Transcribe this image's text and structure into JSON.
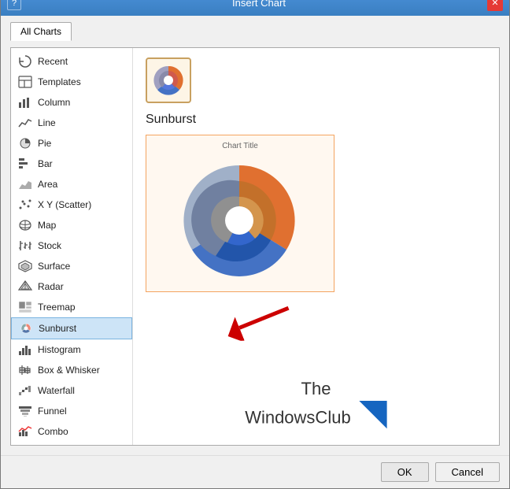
{
  "dialog": {
    "title": "Insert Chart",
    "help_label": "?",
    "close_label": "✕"
  },
  "tabs": [
    {
      "id": "all-charts",
      "label": "All Charts",
      "active": true
    }
  ],
  "sidebar": {
    "items": [
      {
        "id": "recent",
        "label": "Recent",
        "icon": "recent-icon",
        "active": false
      },
      {
        "id": "templates",
        "label": "Templates",
        "icon": "templates-icon",
        "active": false
      },
      {
        "id": "column",
        "label": "Column",
        "icon": "column-icon",
        "active": false
      },
      {
        "id": "line",
        "label": "Line",
        "icon": "line-icon",
        "active": false
      },
      {
        "id": "pie",
        "label": "Pie",
        "icon": "pie-icon",
        "active": false
      },
      {
        "id": "bar",
        "label": "Bar",
        "icon": "bar-icon",
        "active": false
      },
      {
        "id": "area",
        "label": "Area",
        "icon": "area-icon",
        "active": false
      },
      {
        "id": "xyscatter",
        "label": "X Y (Scatter)",
        "icon": "scatter-icon",
        "active": false
      },
      {
        "id": "map",
        "label": "Map",
        "icon": "map-icon",
        "active": false
      },
      {
        "id": "stock",
        "label": "Stock",
        "icon": "stock-icon",
        "active": false
      },
      {
        "id": "surface",
        "label": "Surface",
        "icon": "surface-icon",
        "active": false
      },
      {
        "id": "radar",
        "label": "Radar",
        "icon": "radar-icon",
        "active": false
      },
      {
        "id": "treemap",
        "label": "Treemap",
        "icon": "treemap-icon",
        "active": false
      },
      {
        "id": "sunburst",
        "label": "Sunburst",
        "icon": "sunburst-icon",
        "active": true
      },
      {
        "id": "histogram",
        "label": "Histogram",
        "icon": "histogram-icon",
        "active": false
      },
      {
        "id": "boxwhisker",
        "label": "Box & Whisker",
        "icon": "boxwhisker-icon",
        "active": false
      },
      {
        "id": "waterfall",
        "label": "Waterfall",
        "icon": "waterfall-icon",
        "active": false
      },
      {
        "id": "funnel",
        "label": "Funnel",
        "icon": "funnel-icon",
        "active": false
      },
      {
        "id": "combo",
        "label": "Combo",
        "icon": "combo-icon",
        "active": false
      }
    ]
  },
  "main": {
    "selected_chart_name": "Sunburst",
    "preview_title": "Chart Title",
    "watermark_line1": "The",
    "watermark_line2": "WindowsClub"
  },
  "footer": {
    "ok_label": "OK",
    "cancel_label": "Cancel"
  }
}
